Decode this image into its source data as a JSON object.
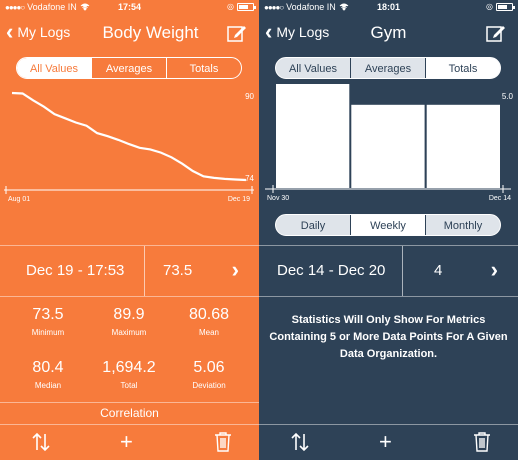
{
  "left": {
    "status": {
      "carrier": "Vodafone IN",
      "time": "17:54"
    },
    "nav": {
      "back_label": "My Logs",
      "title": "Body Weight"
    },
    "tabs": [
      {
        "label": "All Values",
        "selected": true
      },
      {
        "label": "Averages",
        "selected": false
      },
      {
        "label": "Totals",
        "selected": false
      }
    ],
    "chart_data": {
      "type": "line",
      "x_start_label": "Aug 01",
      "x_end_label": "Dec 19",
      "y_max_label": "90",
      "y_min_label": "74",
      "ylim": [
        73.5,
        90
      ],
      "values": [
        90,
        89.9,
        88.6,
        87.4,
        86.0,
        85.2,
        84.4,
        83.8,
        82.4,
        81.8,
        81.1,
        80.3,
        79.6,
        79.3,
        78.7,
        77.8,
        76.6,
        75.2,
        74.2,
        73.9,
        73.7,
        73.6,
        73.5
      ]
    },
    "summary": {
      "date": "Dec 19 - 17:53",
      "value": "73.5"
    },
    "stats": [
      {
        "value": "73.5",
        "label": "Minimum"
      },
      {
        "value": "89.9",
        "label": "Maximum"
      },
      {
        "value": "80.68",
        "label": "Mean"
      },
      {
        "value": "80.4",
        "label": "Median"
      },
      {
        "value": "1,694.2",
        "label": "Total"
      },
      {
        "value": "5.06",
        "label": "Deviation"
      }
    ],
    "correlation_label": "Correlation",
    "icons": {
      "sort": "sort-arrows-icon",
      "add": "plus-icon",
      "delete": "trash-icon"
    },
    "colors": {
      "background": "#f77b3c"
    }
  },
  "right": {
    "status": {
      "carrier": "Vodafone IN",
      "time": "18:01"
    },
    "nav": {
      "back_label": "My Logs",
      "title": "Gym"
    },
    "tabs": [
      {
        "label": "All Values",
        "selected": false
      },
      {
        "label": "Averages",
        "selected": false
      },
      {
        "label": "Totals",
        "selected": true
      }
    ],
    "chart_data": {
      "type": "bar",
      "x_start_label": "Nov 30",
      "x_end_label": "Dec 14",
      "y_max_label": "5.0",
      "ylim": [
        0,
        5
      ],
      "values": [
        5,
        4,
        4
      ]
    },
    "periods": [
      {
        "label": "Daily",
        "selected": false
      },
      {
        "label": "Weekly",
        "selected": true
      },
      {
        "label": "Monthly",
        "selected": false
      }
    ],
    "summary": {
      "date": "Dec 14 - Dec 20",
      "value": "4"
    },
    "note": "Statistics Will Only Show For Metrics Containing 5 or More Data Points For A Given Data Organization.",
    "icons": {
      "sort": "sort-arrows-icon",
      "add": "plus-icon",
      "delete": "trash-icon"
    },
    "colors": {
      "background": "#2e4257"
    }
  }
}
